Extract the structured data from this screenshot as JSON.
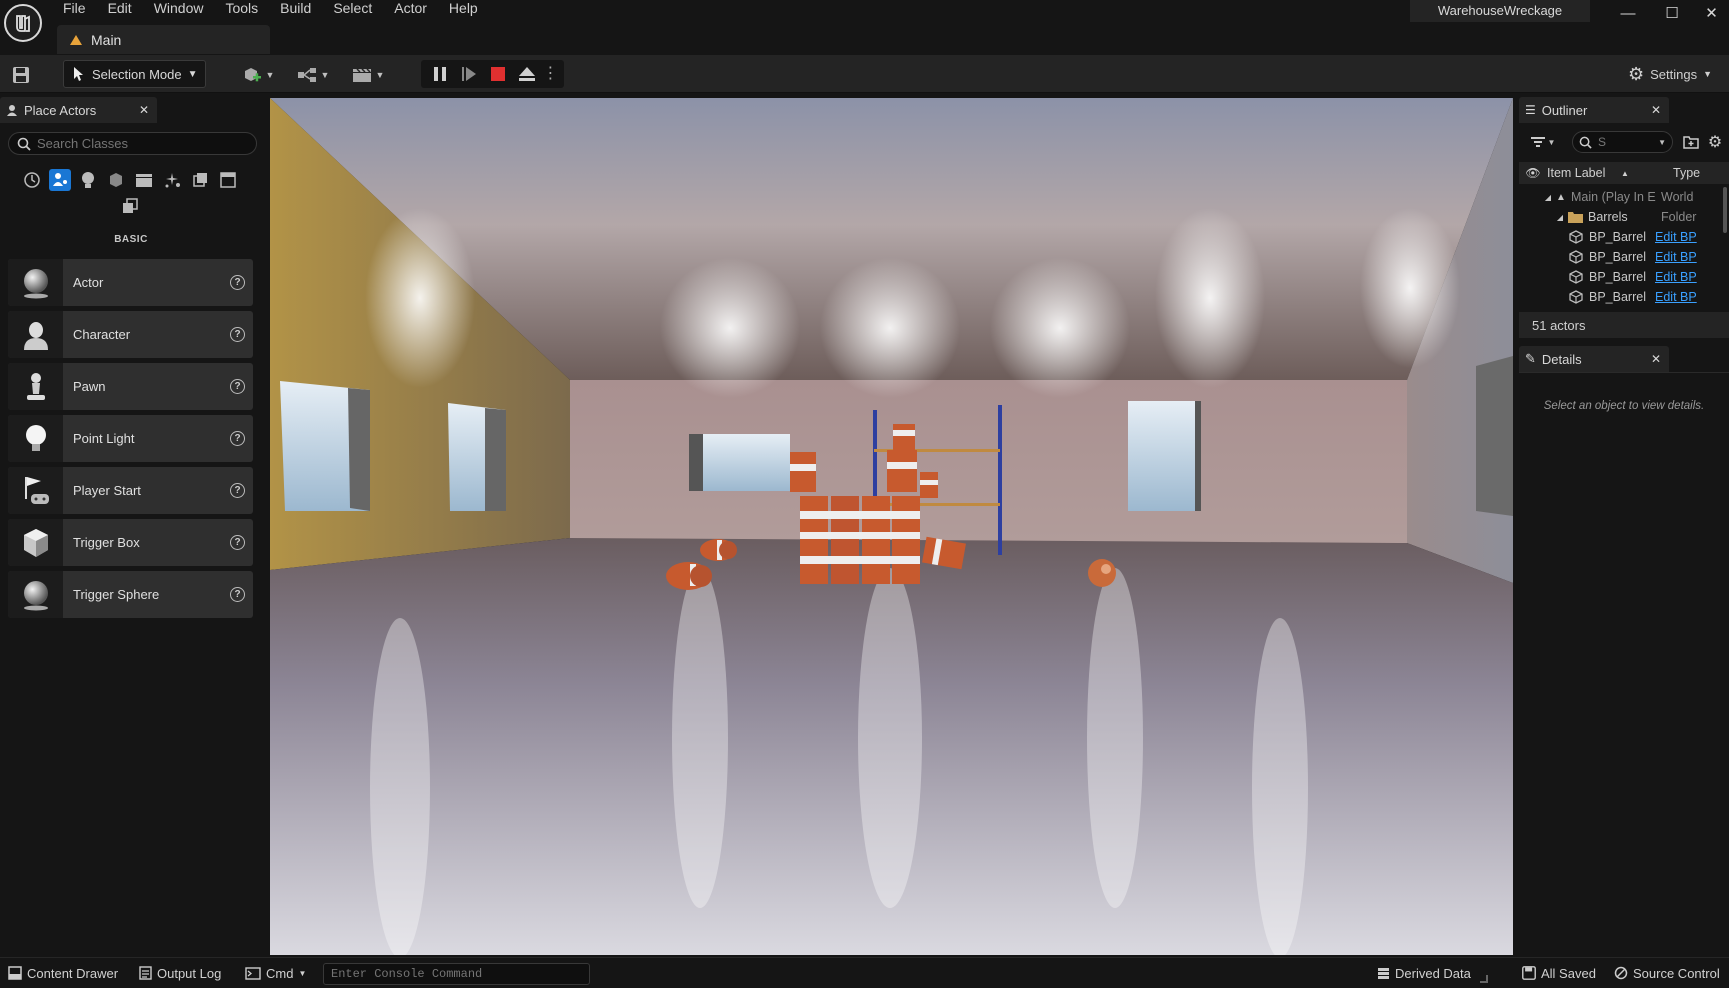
{
  "menu": [
    "File",
    "Edit",
    "Window",
    "Tools",
    "Build",
    "Select",
    "Actor",
    "Help"
  ],
  "project_name": "WarehouseWreckage",
  "level_tab": "Main",
  "toolbar": {
    "selection_mode": "Selection Mode",
    "settings": "Settings"
  },
  "place_actors": {
    "tab_label": "Place Actors",
    "search_placeholder": "Search Classes",
    "category_label": "BASIC",
    "categories": [
      "recent-icon",
      "basic-icon",
      "lights-icon",
      "shapes-icon",
      "cinematic-icon",
      "visual-effects-icon",
      "volumes-icon",
      "all-classes-icon",
      "geometry-icon"
    ],
    "items": [
      {
        "label": "Actor",
        "icon": "sphere-icon"
      },
      {
        "label": "Character",
        "icon": "character-icon"
      },
      {
        "label": "Pawn",
        "icon": "pawn-icon"
      },
      {
        "label": "Point Light",
        "icon": "bulb-icon"
      },
      {
        "label": "Player Start",
        "icon": "player-start-icon"
      },
      {
        "label": "Trigger Box",
        "icon": "cube-icon"
      },
      {
        "label": "Trigger Sphere",
        "icon": "sphere-icon"
      }
    ]
  },
  "outliner": {
    "tab_label": "Outliner",
    "search_value": "S",
    "col_label": "Item Label",
    "col_type": "Type",
    "rows": [
      {
        "label": "Main (Play In E",
        "type": "World"
      },
      {
        "label": "Barrels",
        "type": "Folder"
      },
      {
        "label": "BP_Barrel",
        "type": "Edit BP"
      },
      {
        "label": "BP_Barrel",
        "type": "Edit BP"
      },
      {
        "label": "BP_Barrel",
        "type": "Edit BP"
      },
      {
        "label": "BP_Barrel",
        "type": "Edit BP"
      }
    ],
    "count": "51 actors"
  },
  "details": {
    "tab_label": "Details",
    "empty_text": "Select an object to view details."
  },
  "status": {
    "content_drawer": "Content Drawer",
    "output_log": "Output Log",
    "cmd": "Cmd",
    "console_placeholder": "Enter Console Command",
    "derived_data": "Derived Data",
    "all_saved": "All Saved",
    "source_control": "Source Control"
  }
}
